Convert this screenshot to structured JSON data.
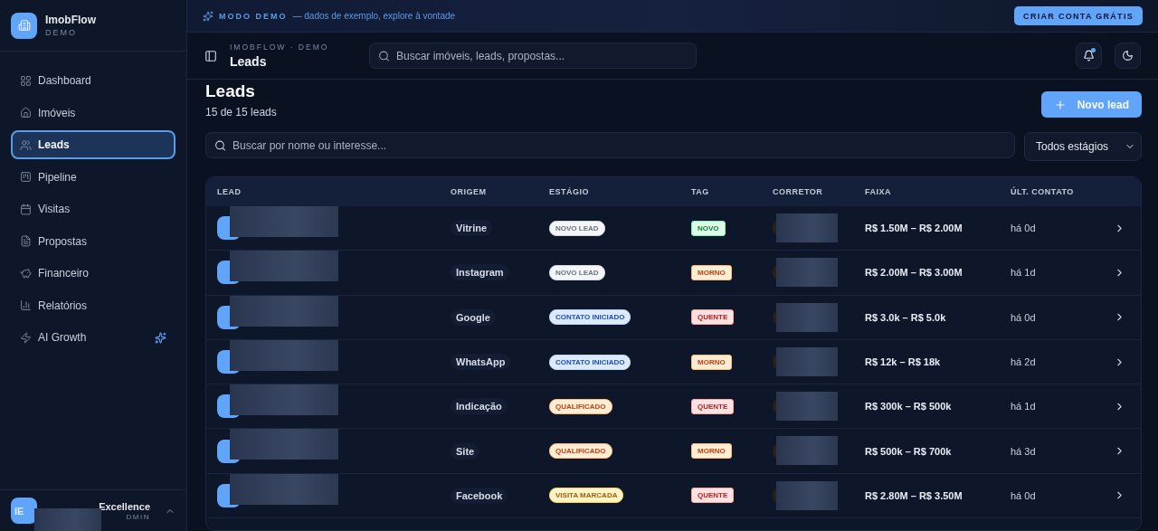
{
  "brand": {
    "name": "ImobFlow",
    "subtitle": "DEMO"
  },
  "sidebar": {
    "items": [
      {
        "label": "Dashboard",
        "selected": false,
        "sparkle": false
      },
      {
        "label": "Imóveis",
        "selected": false,
        "sparkle": false
      },
      {
        "label": "Leads",
        "selected": true,
        "sparkle": false
      },
      {
        "label": "Pipeline",
        "selected": false,
        "sparkle": false
      },
      {
        "label": "Visitas",
        "selected": false,
        "sparkle": false
      },
      {
        "label": "Propostas",
        "selected": false,
        "sparkle": false
      },
      {
        "label": "Financeiro",
        "selected": false,
        "sparkle": false
      },
      {
        "label": "Relatórios",
        "selected": false,
        "sparkle": false
      },
      {
        "label": "AI Growth",
        "selected": false,
        "sparkle": true
      }
    ]
  },
  "user": {
    "initials": "IE",
    "name": "Excellence",
    "role": "DMIN"
  },
  "demo_banner": {
    "label": "MODO DEMO",
    "text": "— dados de exemplo, explore à vontade",
    "button": "CRIAR CONTA GRÁTIS"
  },
  "header": {
    "breadcrumb": "IMOBFLOW · DEMO",
    "title": "Leads",
    "search_placeholder": "Buscar imóveis, leads, propostas...",
    "notifications_unread": true
  },
  "page": {
    "title": "Leads",
    "count": "15 de 15 leads",
    "new_button": "Novo lead",
    "search_placeholder": "Buscar por nome ou interesse...",
    "stage_filter": "Todos estágios"
  },
  "table": {
    "columns": [
      "LEAD",
      "ORIGEM",
      "ESTÁGIO",
      "TAG",
      "CORRETOR",
      "FAIXA",
      "ÚLT. CONTATO"
    ],
    "rows": [
      {
        "origin": "Vitrine",
        "stage": {
          "label": "NOVO LEAD",
          "kind": "new"
        },
        "tag": {
          "label": "NOVO",
          "kind": "new"
        },
        "range": "R$ 1.50M – R$ 2.00M",
        "last_contact": "há 0d"
      },
      {
        "origin": "Instagram",
        "stage": {
          "label": "NOVO LEAD",
          "kind": "new"
        },
        "tag": {
          "label": "MORNO",
          "kind": "warm"
        },
        "range": "R$ 2.00M – R$ 3.00M",
        "last_contact": "há 1d"
      },
      {
        "origin": "Google",
        "stage": {
          "label": "CONTATO INICIADO",
          "kind": "contact"
        },
        "tag": {
          "label": "QUENTE",
          "kind": "hot"
        },
        "range": "R$ 3.0k – R$ 5.0k",
        "last_contact": "há 0d"
      },
      {
        "origin": "WhatsApp",
        "stage": {
          "label": "CONTATO INICIADO",
          "kind": "contact"
        },
        "tag": {
          "label": "MORNO",
          "kind": "warm"
        },
        "range": "R$ 12k – R$ 18k",
        "last_contact": "há 2d"
      },
      {
        "origin": "Indicação",
        "stage": {
          "label": "QUALIFICADO",
          "kind": "qualified"
        },
        "tag": {
          "label": "QUENTE",
          "kind": "hot"
        },
        "range": "R$ 300k – R$ 500k",
        "last_contact": "há 1d"
      },
      {
        "origin": "Site",
        "stage": {
          "label": "QUALIFICADO",
          "kind": "qualified"
        },
        "tag": {
          "label": "MORNO",
          "kind": "warm"
        },
        "range": "R$ 500k – R$ 700k",
        "last_contact": "há 3d"
      },
      {
        "origin": "Facebook",
        "stage": {
          "label": "VISITA MARCADA",
          "kind": "visit"
        },
        "tag": {
          "label": "QUENTE",
          "kind": "hot"
        },
        "range": "R$ 2.80M – R$ 3.50M",
        "last_contact": "há 0d"
      }
    ]
  }
}
